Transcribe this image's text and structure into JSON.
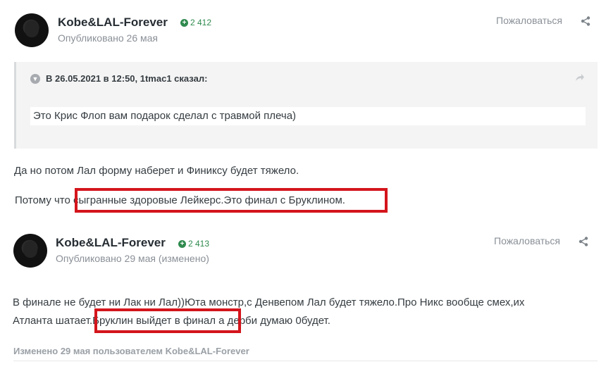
{
  "posts": [
    {
      "author": "Kobe&LAL-Forever",
      "reputation": "2 412",
      "published": "Опубликовано 26 мая",
      "report_label": "Пожаловаться",
      "quote": {
        "header": "В 26.05.2021 в 12:50, 1tmac1 сказал:",
        "text": "Это Крис Флоп вам подарок сделал с травмой плеча)"
      },
      "paragraphs": [
        "Да но потом Лал форму наберет и Финиксу будет тяжело.",
        "Потому что сыгранные здоровые Лейкерс.Это финал с Бруклином."
      ]
    },
    {
      "author": "Kobe&LAL-Forever",
      "reputation": "2 413",
      "published": "Опубликовано 29 мая (изменено)",
      "report_label": "Пожаловаться",
      "paragraphs": [
        "В финале не будет ни Лак ни Лал))Юта монстр,с Денвепом Лал будет тяжело.Про Никс вообще смех,их",
        "Атланта шатает.Бруклин выйдет в финал а дерби думаю 0будет."
      ],
      "edited_note": "Изменено 29 мая пользователем Kobe&LAL-Forever"
    }
  ],
  "icons": {
    "share": "share-icon",
    "reputation": "plus-circle-icon",
    "quote_toggle": "chevron-down-icon",
    "quote_link": "reply-arrow-icon"
  },
  "colors": {
    "highlight_box": "#d4151c",
    "reputation": "#2f8a4e",
    "quote_bg": "#f4f4f4"
  }
}
